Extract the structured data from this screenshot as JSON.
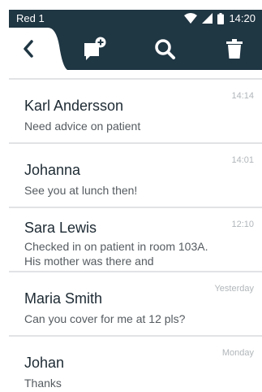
{
  "status_bar": {
    "carrier": "Red 1",
    "time": "14:20",
    "icons": [
      "wifi-icon",
      "signal-icon",
      "battery-icon"
    ]
  },
  "toolbar": {
    "buttons": [
      "back-icon",
      "new-message-icon",
      "search-icon",
      "delete-icon"
    ]
  },
  "conversations": [
    {
      "name": "Karl Andersson",
      "preview": "Need advice on patient",
      "time": "14:14"
    },
    {
      "name": "Johanna",
      "preview": "See you at lunch then!",
      "time": "14:01"
    },
    {
      "name": "Sara Lewis",
      "preview": "Checked in on patient in room 103A. His mother was there and",
      "time": "12:10"
    },
    {
      "name": "Maria Smith",
      "preview": "Can you cover for me at 12 pls?",
      "time": "Yesterday"
    },
    {
      "name": "Johan",
      "preview": "Thanks",
      "time": "Monday"
    }
  ],
  "colors": {
    "bar": "#1f3643",
    "divider": "#e1e3e5",
    "timestamp": "#b1b6ba"
  }
}
